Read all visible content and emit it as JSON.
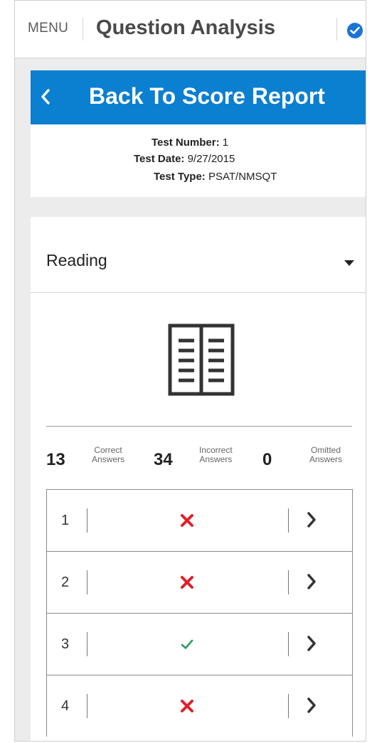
{
  "header": {
    "menu_label": "MENU",
    "title": "Question Analysis"
  },
  "back": {
    "label": "Back To Score Report"
  },
  "test_info": {
    "number_label": "Test Number:",
    "number_value": "1",
    "date_label": "Test Date:",
    "date_value": "9/27/2015",
    "type_label": "Test Type:",
    "type_value": "PSAT/NMSQT"
  },
  "section": {
    "selected": "Reading"
  },
  "stats": {
    "correct_count": "13",
    "correct_label_1": "Correct",
    "correct_label_2": "Answers",
    "incorrect_count": "34",
    "incorrect_label_1": "Incorrect",
    "incorrect_label_2": "Answers",
    "omitted_count": "0",
    "omitted_label_1": "Omitted",
    "omitted_label_2": "Answers"
  },
  "questions": [
    {
      "number": "1",
      "result": "incorrect"
    },
    {
      "number": "2",
      "result": "incorrect"
    },
    {
      "number": "3",
      "result": "correct"
    },
    {
      "number": "4",
      "result": "incorrect"
    }
  ],
  "colors": {
    "accent": "#0b7fd0",
    "badge": "#1a73d9",
    "incorrect": "#e0202a",
    "correct": "#2e9b5d"
  },
  "icons": {
    "header_badge": "check-circle-icon",
    "back": "chevron-left-icon",
    "dropdown": "caret-down-icon",
    "section": "open-book-icon",
    "incorrect": "x-mark-icon",
    "correct": "check-mark-icon",
    "row_arrow": "chevron-right-icon"
  }
}
